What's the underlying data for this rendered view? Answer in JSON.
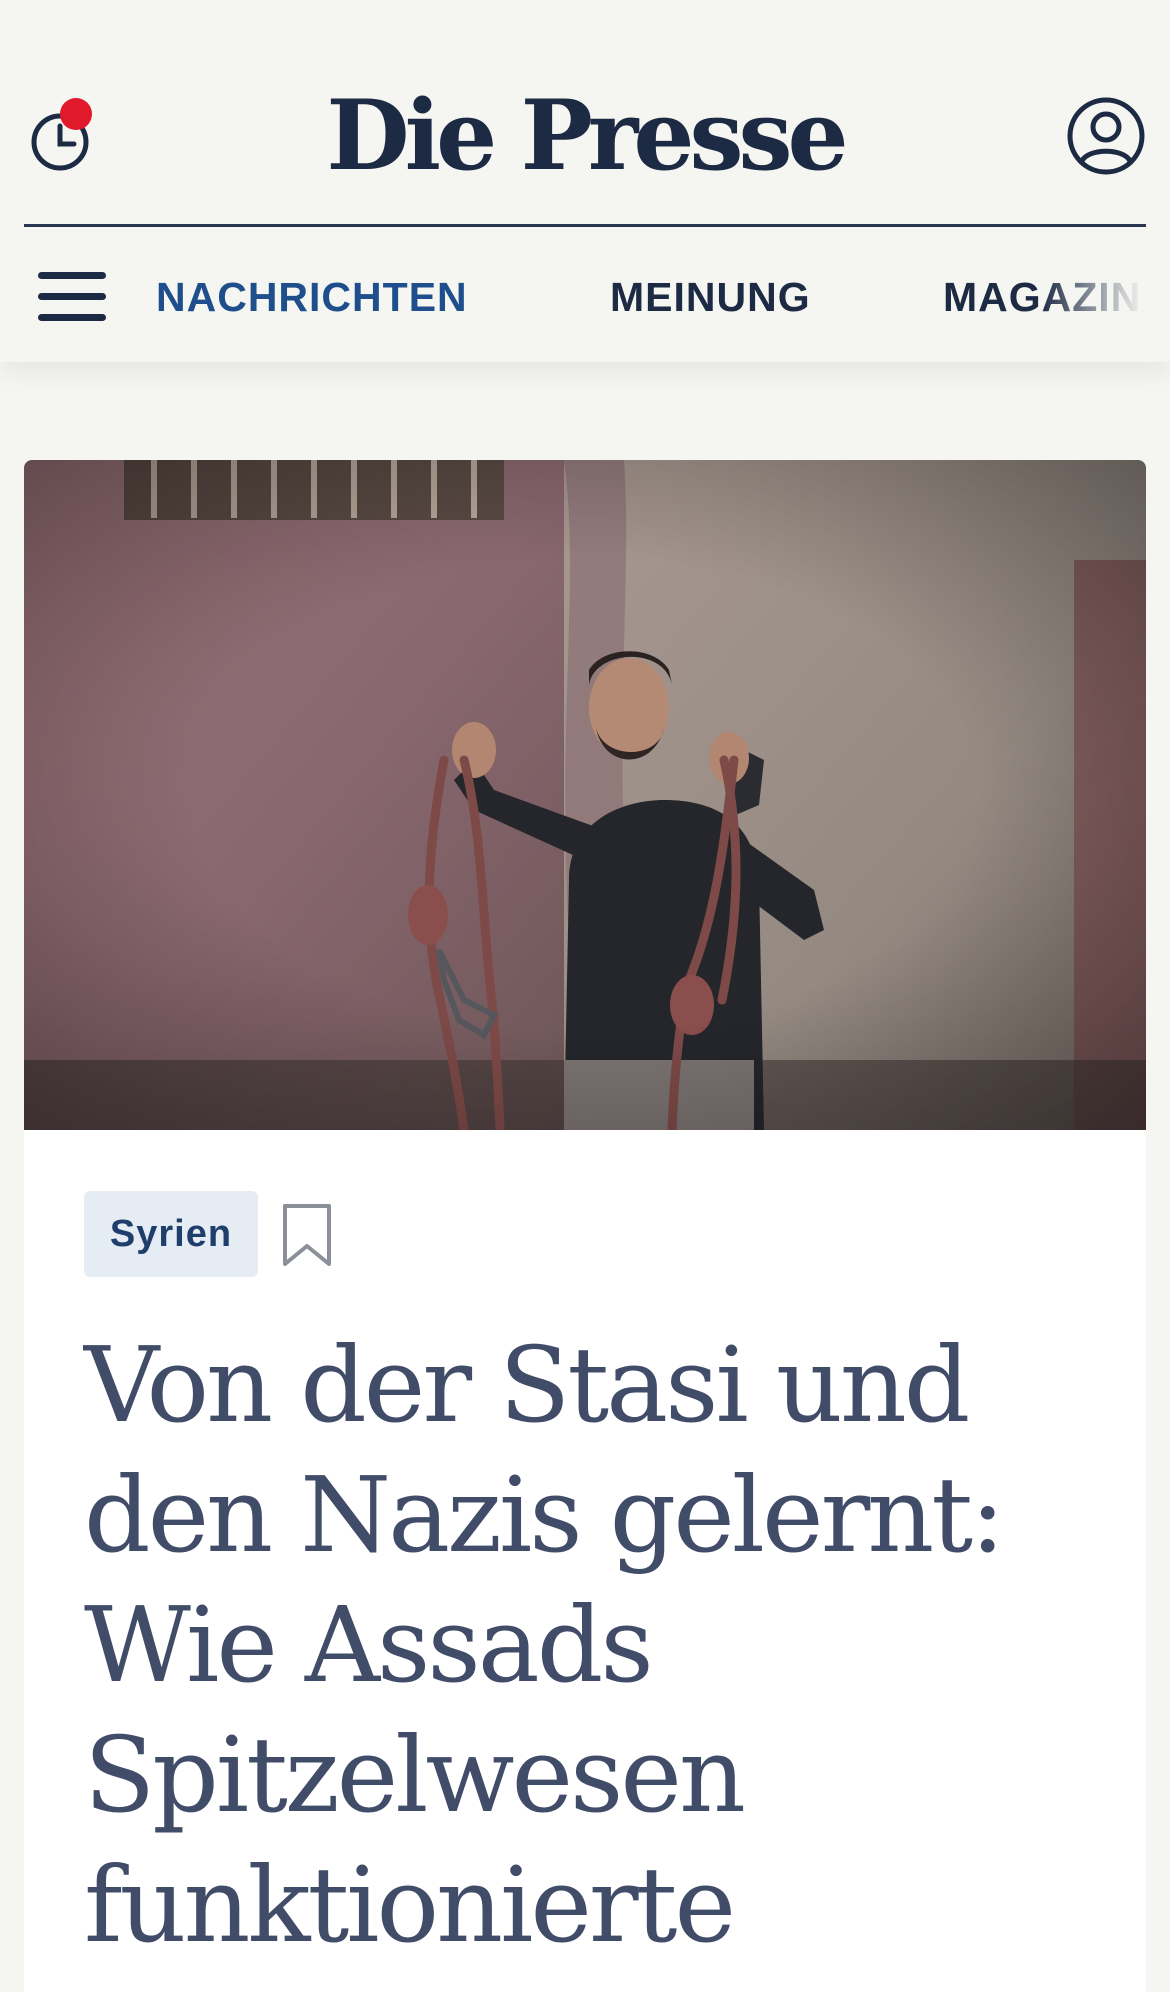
{
  "header": {
    "logo": "Die Presse",
    "history_icon": "clock-icon",
    "account_icon": "user-circle-icon",
    "notification_color": "#e0192b"
  },
  "nav": {
    "menu_icon": "hamburger-menu-icon",
    "items": [
      {
        "label": "NACHRICHTEN",
        "active": true
      },
      {
        "label": "MEINUNG",
        "active": false
      },
      {
        "label": "MAGAZIN",
        "active": false
      }
    ]
  },
  "article": {
    "image_alt": "Mann hält Stricke in einem Raum mit roter und grauer Wand",
    "tag": "Syrien",
    "bookmark_icon": "bookmark-icon",
    "headline": "Von der Stasi und den Nazis gelernt: Wie Assads Spitzelwesen funktionierte"
  },
  "colors": {
    "brand": "#1c2a44",
    "active_nav": "#1f4e8c",
    "headline": "#414c69",
    "tag_bg": "#e6ecf3"
  }
}
